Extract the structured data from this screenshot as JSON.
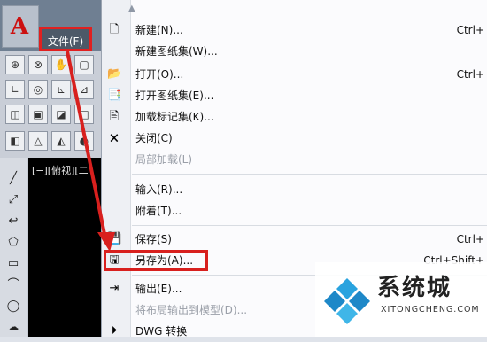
{
  "app": {
    "file_tab": "文件(F)"
  },
  "viewport": {
    "label": "[−][俯视][二"
  },
  "menu": {
    "items": [
      {
        "label": "新建(N)...",
        "shortcut": "Ctrl+",
        "icon": "new-doc-icon",
        "disabled": false
      },
      {
        "label": "新建图纸集(W)...",
        "shortcut": "",
        "icon": "",
        "disabled": false
      },
      {
        "label": "打开(O)...",
        "shortcut": "Ctrl+",
        "icon": "open-folder-icon",
        "disabled": false
      },
      {
        "label": "打开图纸集(E)...",
        "shortcut": "",
        "icon": "open-sheetset-icon",
        "disabled": false
      },
      {
        "label": "加载标记集(K)...",
        "shortcut": "",
        "icon": "markup-icon",
        "disabled": false
      },
      {
        "label": "关闭(C)",
        "shortcut": "",
        "icon": "close-doc-icon",
        "disabled": false
      },
      {
        "label": "局部加载(L)",
        "shortcut": "",
        "icon": "",
        "disabled": true
      },
      {
        "label": "输入(R)...",
        "shortcut": "",
        "icon": "",
        "disabled": false
      },
      {
        "label": "附着(T)...",
        "shortcut": "",
        "icon": "",
        "disabled": false
      },
      {
        "label": "保存(S)",
        "shortcut": "Ctrl+",
        "icon": "save-icon",
        "disabled": false
      },
      {
        "label": "另存为(A)...",
        "shortcut": "Ctrl+Shift+",
        "icon": "save-as-icon",
        "disabled": false
      },
      {
        "label": "输出(E)...",
        "shortcut": "",
        "icon": "export-icon",
        "disabled": false
      },
      {
        "label": "将布局输出到模型(D)...",
        "shortcut": "",
        "icon": "",
        "disabled": true
      },
      {
        "label": "DWG 转换",
        "shortcut": "",
        "icon": "dwg-convert-icon",
        "disabled": false
      }
    ]
  },
  "watermark": {
    "title": "系统城",
    "subtitle": "XITONGCHENG.COM"
  },
  "colors": {
    "highlight": "#d8201e",
    "menu_bg": "#fbfbfd"
  }
}
